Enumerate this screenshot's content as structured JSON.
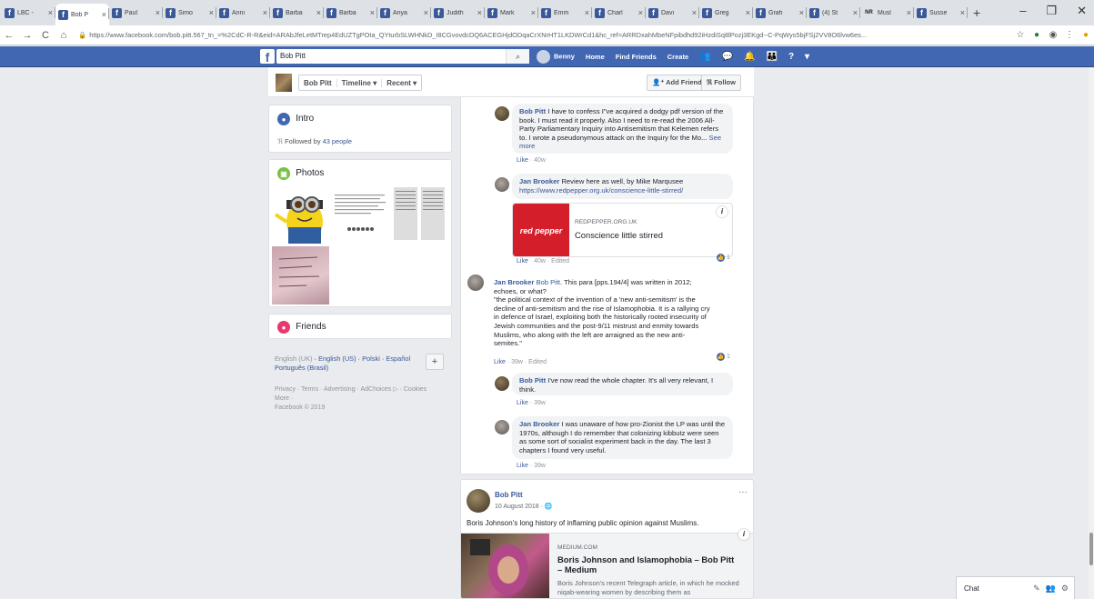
{
  "browser": {
    "tabs": [
      {
        "label": "LBC -",
        "active": false
      },
      {
        "label": "Bob P",
        "active": true
      },
      {
        "label": "Paul",
        "active": false
      },
      {
        "label": "Simo",
        "active": false
      },
      {
        "label": "Anni",
        "active": false
      },
      {
        "label": "Barba",
        "active": false
      },
      {
        "label": "Barba",
        "active": false
      },
      {
        "label": "Anya",
        "active": false
      },
      {
        "label": "Judith",
        "active": false
      },
      {
        "label": "Mark",
        "active": false
      },
      {
        "label": "Emm",
        "active": false
      },
      {
        "label": "Charl",
        "active": false
      },
      {
        "label": "Davi",
        "active": false
      },
      {
        "label": "Greg",
        "active": false
      },
      {
        "label": "Grah",
        "active": false
      },
      {
        "label": "(4) St",
        "active": false
      },
      {
        "label": "Musl",
        "active": false,
        "favicon": "NR"
      },
      {
        "label": "Susse",
        "active": false
      }
    ],
    "url": "https://www.facebook.com/bob.pitt.567_tn_=%2CdC-R-R&eid=ARAbJfeLetMTrep4EdUZTgPOta_QYturbSLWHNkD_I8CGvovdcDQ6ACEGHjdODqaCrXNrHT1LKDWrCd1&hc_ref=ARRDxahMbeNFpibdhd92iHzdiSq8lPozj3EKgd--C-PqWys5bjFSj2VV8O6lvw6es..."
  },
  "fb": {
    "search_value": "Bob Pitt",
    "nav": {
      "user": "Benny",
      "home": "Home",
      "find_friends": "Find Friends",
      "create": "Create"
    }
  },
  "profile_header": {
    "name": "Bob Pitt",
    "timeline": "Timeline ▾",
    "recent": "Recent ▾",
    "add_friend": "Add Friend",
    "follow": "Follow"
  },
  "intro": {
    "title": "Intro",
    "followed_prefix": "Followed by ",
    "followed_link": "43 people"
  },
  "photos": {
    "title": "Photos"
  },
  "friends": {
    "title": "Friends"
  },
  "languages": {
    "items": [
      "English (UK)",
      "English (US)",
      "Polski",
      "Español",
      "Português (Brasil)"
    ]
  },
  "footer": {
    "links": [
      "Privacy",
      "Terms",
      "Advertising",
      "AdChoices",
      "Cookies",
      "More"
    ],
    "copyright": "Facebook © 2019"
  },
  "comments": [
    {
      "name": "Bob Pitt",
      "text": " I have to confess I\"ve acquired a dodgy pdf version of the book. I must read it properly. Also I need to re-read the 2006 All-Party Parliamentary Inquiry into Antisemitism that Kelemen refers to. I wrote a pseudonymous attack on the Inquiry for the Mo...",
      "see_more": "See more",
      "like": "Like",
      "time": "40w"
    },
    {
      "name": "Jan Brooker",
      "text": " Review here as well, by Mike Marqusee",
      "link": "https://www.redpepper.org.uk/conscience-little-stirred/",
      "preview_domain": "REDPEPPER.ORG.UK",
      "preview_title": "Conscience little stirred",
      "preview_logo": "red pepper",
      "like": "Like",
      "time": "40w",
      "edited": "Edited",
      "reactions": "1"
    },
    {
      "name": "Jan Brooker",
      "mention": "Bob Pitt",
      "text_lines": [
        ". This para [pps.194/4] was written in 2012;",
        "echoes, or what?",
        "\"the political context of the invention of a 'new anti-semitism' is the",
        "decline of anti-semitism and the rise of Islamophobia. It is a rallying cry",
        "in defence of Israel, exploiting both the historically rooted insecurity of",
        "Jewish communities and the post-9/11 mistrust and enmity towards",
        "Muslims, who along with the left are arraigned as the new anti-",
        "semites.\""
      ],
      "like": "Like",
      "time": "39w",
      "edited": "Edited",
      "reactions": "1"
    },
    {
      "name": "Bob Pitt",
      "text": " I've now read the whole chapter. It's all very relevant, I think.",
      "like": "Like",
      "time": "39w"
    },
    {
      "name": "Jan Brooker",
      "text": " I was unaware of how pro-Zionist the LP was until the 1970s, although I do remember that colonizing kibbutz were seen as some sort of socialist experiment back in the day. The last 3 chapters I found very useful.",
      "like": "Like",
      "time": "39w"
    }
  ],
  "post": {
    "author": "Bob Pitt",
    "date": "10 August 2018",
    "text": "Boris Johnson's long history of inflaming public opinion against Muslims.",
    "link_domain": "MEDIUM.COM",
    "link_title": "Boris Johnson and Islamophobia – Bob Pitt – Medium",
    "link_desc": "Boris Johnson's recent Telegraph article, in which he mocked niqab-wearing women by describing them as"
  },
  "chat": {
    "label": "Chat"
  },
  "colors": {
    "fb_blue": "#4267b2",
    "link": "#385898"
  }
}
